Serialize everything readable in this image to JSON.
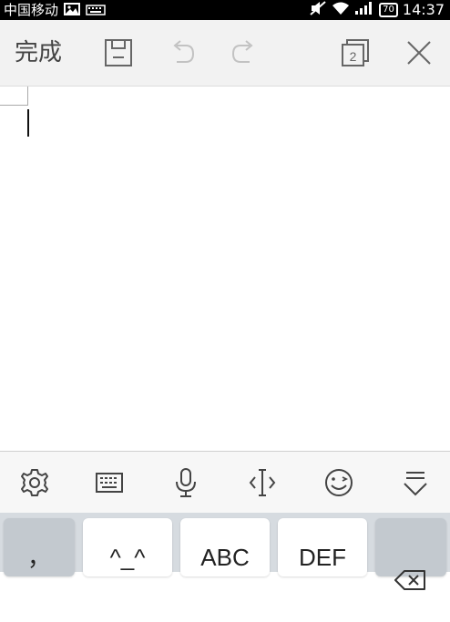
{
  "status_bar": {
    "carrier": "中国移动",
    "battery": "70",
    "time": "14:37",
    "icons": [
      "image-icon",
      "keyboard-notif-icon",
      "mute-icon",
      "wifi-icon",
      "signal-icon"
    ]
  },
  "toolbar": {
    "done_label": "完成",
    "page_count": "2",
    "icons": [
      "save-icon",
      "undo-icon",
      "redo-icon",
      "pages-icon",
      "close-icon"
    ]
  },
  "keyboard_toolbar": {
    "icons": [
      "settings-icon",
      "keyboard-icon",
      "microphone-icon",
      "cursor-icon",
      "emoji-icon",
      "hide-keyboard-icon"
    ]
  },
  "keys": {
    "punct": "，",
    "emoticon": "^_^",
    "abc": "ABC",
    "def": "DEF"
  },
  "colors": {
    "status_bar_bg": "#000000",
    "toolbar_bg": "#f2f2f2",
    "keyboard_bg": "#d6dbe0",
    "key_bg": "#ffffff"
  }
}
